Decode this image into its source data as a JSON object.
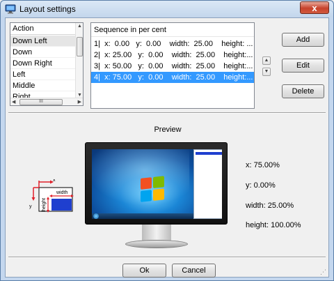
{
  "window": {
    "title": "Layout settings",
    "close_label": "x"
  },
  "action_list": {
    "header": "Action",
    "items": [
      "Down Left",
      "Down",
      "Down Right",
      "Left",
      "Middle",
      "Right"
    ],
    "selected_index": 0,
    "hscroll_thumb_label": "III"
  },
  "sequence": {
    "header": "Sequence in per cent",
    "items": [
      "1|  x:  0.00   y:  0.00    width:  25.00    height: ...",
      "2|  x: 25.00   y:  0.00    width:  25.00    height:...",
      "3|  x: 50.00   y:  0.00    width:  25.00    height:...",
      "4|  x: 75.00   y:  0.00    width:  25.00    height:..."
    ],
    "selected_index": 3
  },
  "buttons": {
    "add": "Add",
    "edit": "Edit",
    "delete": "Delete",
    "ok": "Ok",
    "cancel": "Cancel"
  },
  "preview": {
    "label": "Preview",
    "x": "x: 75.00%",
    "y": "y: 0.00%",
    "width": "width: 25.00%",
    "height": "height: 100.00%",
    "legend_x": "x",
    "legend_y": "y",
    "legend_width": "width",
    "legend_height": "height"
  },
  "colors": {
    "selection": "#3399ff",
    "preview_bar": "#1f3fcf",
    "legend_red": "#e0202a",
    "legend_blue": "#1f3fcf"
  },
  "icons": {
    "title": "window-app-icon",
    "close": "close-icon",
    "scroll_up": "chevron-up-icon",
    "scroll_down": "chevron-down-icon"
  }
}
